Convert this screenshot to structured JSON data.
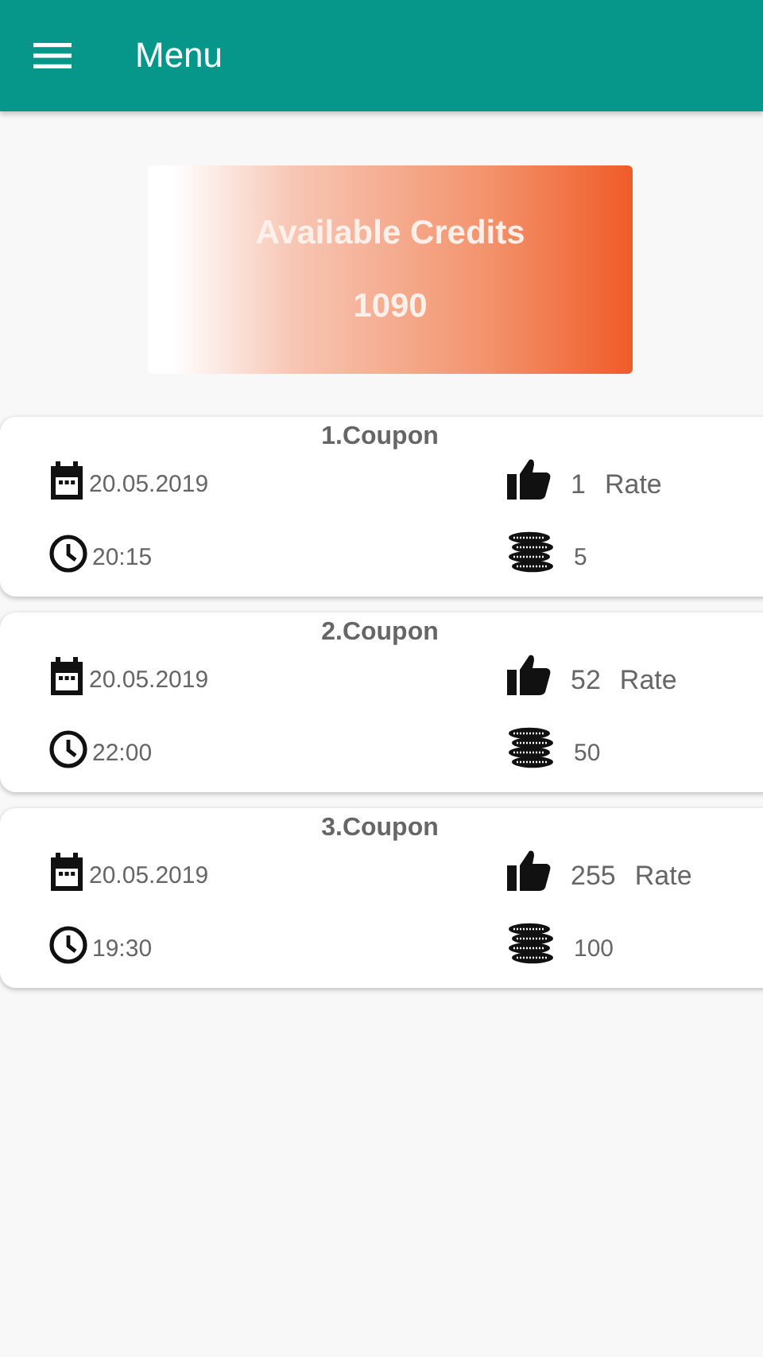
{
  "app_bar": {
    "title": "Menu"
  },
  "credits": {
    "label": "Available Credits",
    "value": "1090"
  },
  "coupons": [
    {
      "title": "1.Coupon",
      "date": "20.05.2019",
      "time": "20:15",
      "likes": "1",
      "rate_label": "Rate",
      "coins": "5"
    },
    {
      "title": "2.Coupon",
      "date": "20.05.2019",
      "time": "22:00",
      "likes": "52",
      "rate_label": "Rate",
      "coins": "50"
    },
    {
      "title": "3.Coupon",
      "date": "20.05.2019",
      "time": "19:30",
      "likes": "255",
      "rate_label": "Rate",
      "coins": "100"
    }
  ]
}
